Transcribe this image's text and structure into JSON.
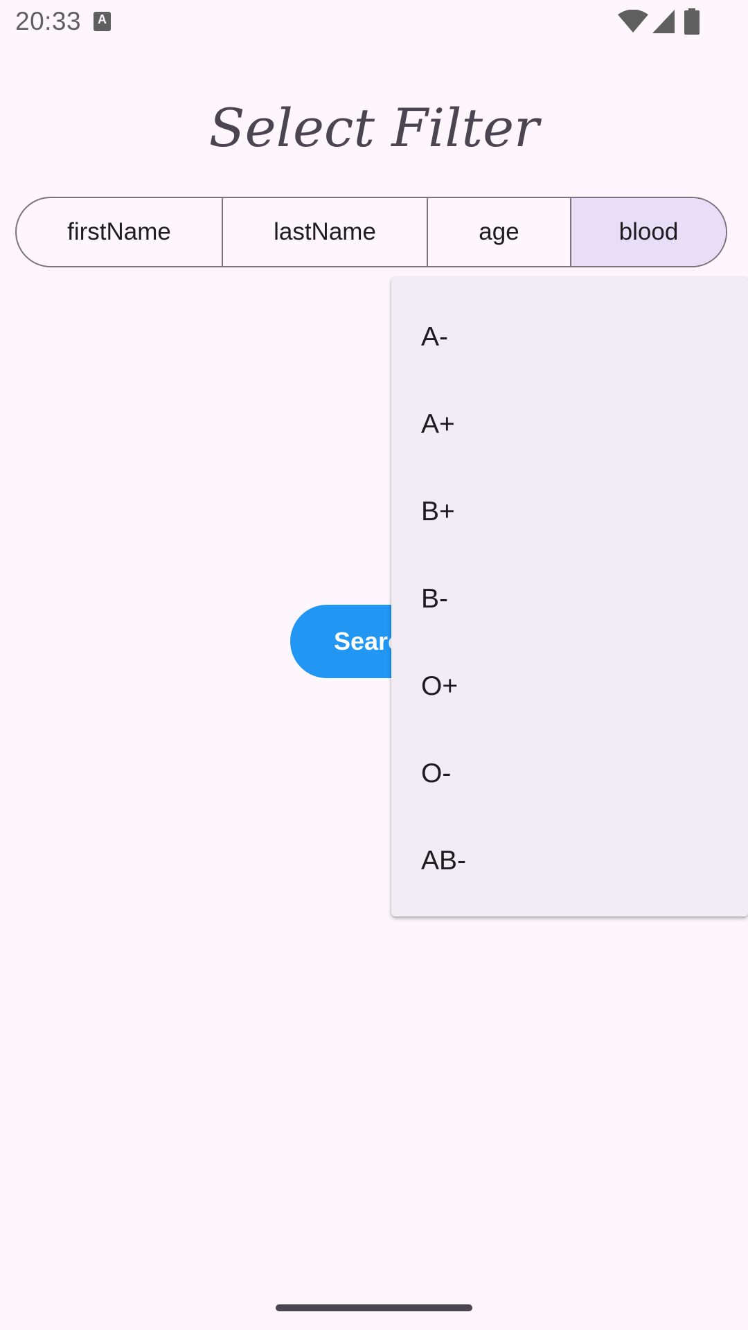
{
  "status_bar": {
    "time": "20:33",
    "app_icon_letter": "A",
    "icons": [
      "wifi-icon",
      "cell-signal-icon",
      "battery-icon"
    ]
  },
  "title": "Select Filter",
  "filter_segments": [
    {
      "label": "firstName",
      "selected": false
    },
    {
      "label": "lastName",
      "selected": false
    },
    {
      "label": "age",
      "selected": false
    },
    {
      "label": "blood",
      "selected": true
    }
  ],
  "search_button": {
    "label": "Search"
  },
  "dropdown": {
    "options": [
      "A-",
      "A+",
      "B+",
      "B-",
      "O+",
      "O-",
      "AB-"
    ]
  },
  "colors": {
    "background": "#FDF7FD",
    "selected_segment": "#E8DEF8",
    "search_button": "#2196F3",
    "dropdown_background": "#F2EDF4",
    "outline": "#79747E"
  }
}
